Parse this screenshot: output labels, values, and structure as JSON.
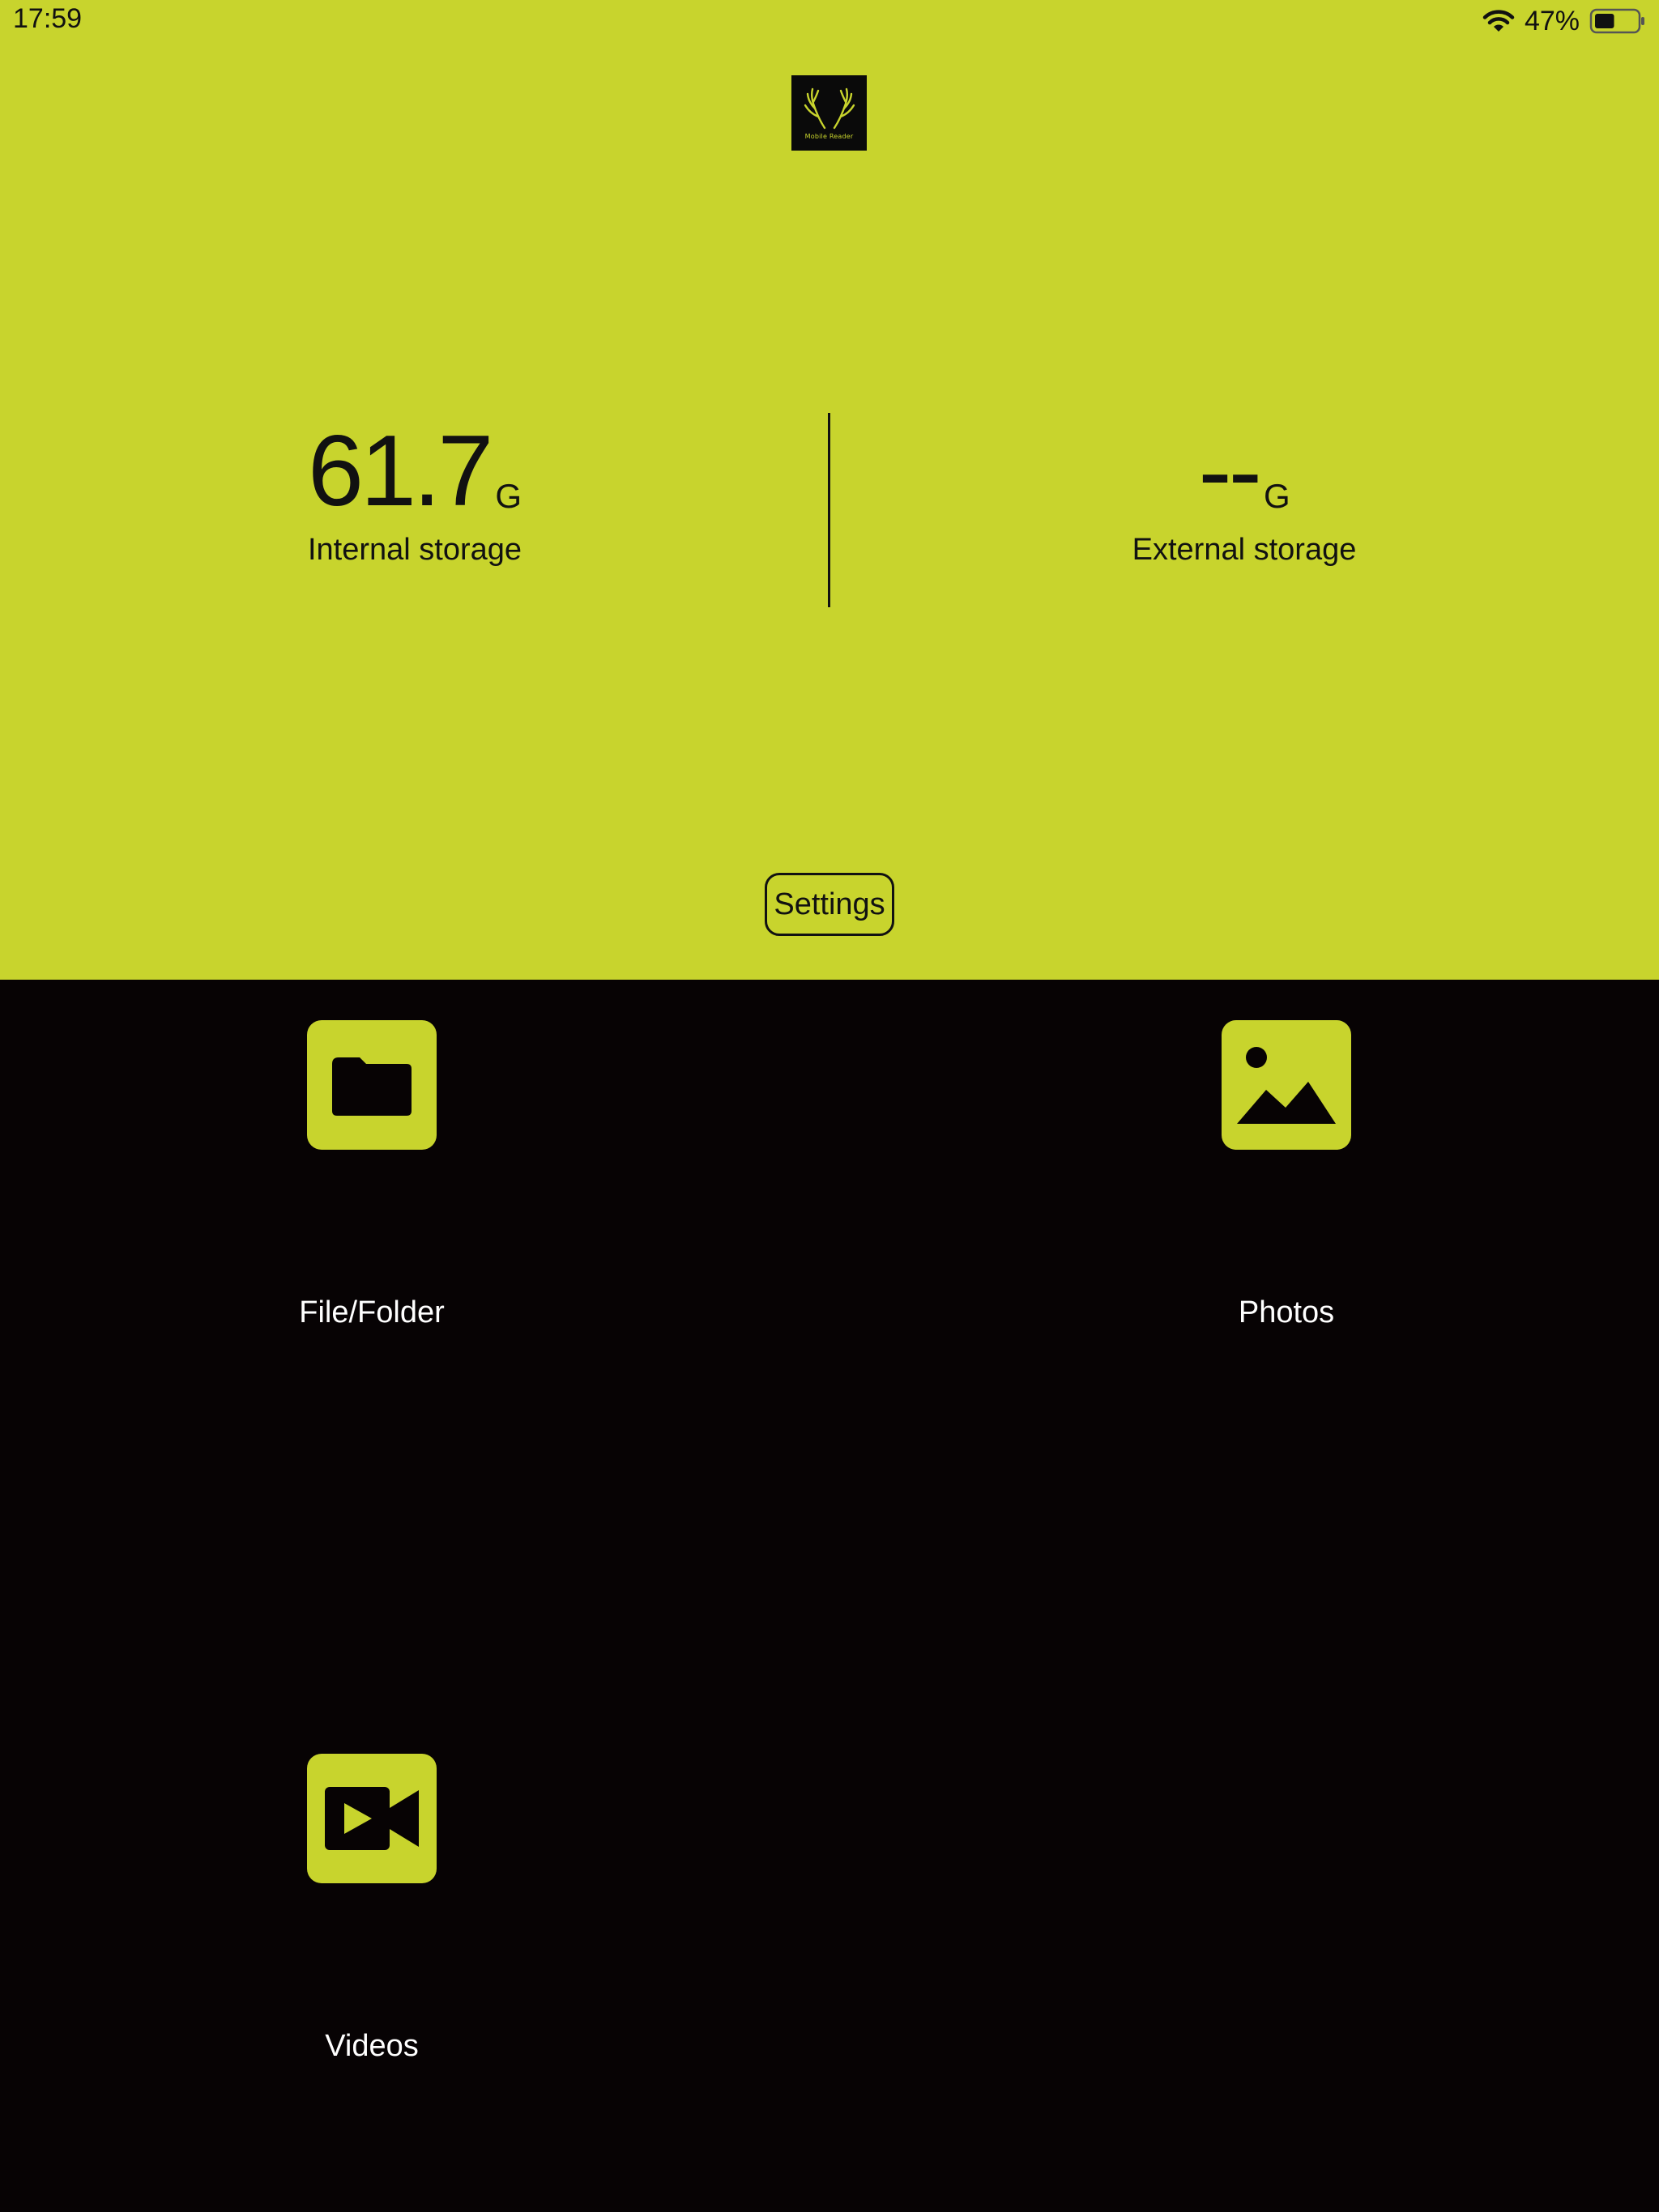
{
  "status_bar": {
    "time": "17:59",
    "battery_percent_text": "47%",
    "battery_level": 0.47,
    "wifi_icon": "wifi-icon",
    "battery_icon": "battery-icon"
  },
  "logo": {
    "text": "Mobile Reader",
    "icon": "antlers-logo"
  },
  "storage": {
    "internal": {
      "value": "61.7",
      "unit": "G",
      "label": "Internal storage"
    },
    "external": {
      "value": "--",
      "unit": "G",
      "label": "External storage"
    }
  },
  "settings": {
    "label": "Settings"
  },
  "tiles": [
    {
      "label": "File/Folder",
      "icon": "folder-icon"
    },
    {
      "label": "Photos",
      "icon": "image-icon"
    },
    {
      "label": "Videos",
      "icon": "video-camera-icon"
    }
  ],
  "colors": {
    "accent": "#c8d42d",
    "dark": "#070304"
  }
}
